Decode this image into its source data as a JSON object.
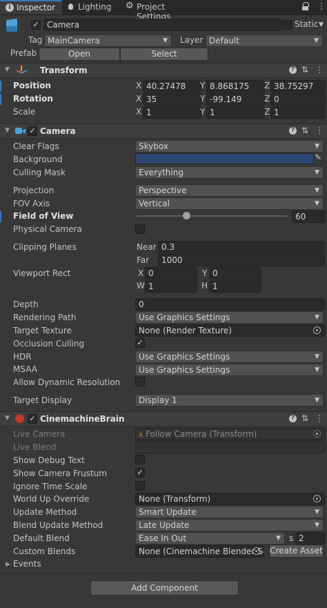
{
  "tabs": [
    {
      "label": "Inspector"
    },
    {
      "label": "Lighting"
    },
    {
      "label": "Project Settings"
    }
  ],
  "object": {
    "name": "Camera",
    "static_label": "Static",
    "tag_label": "Tag",
    "tag_value": "MainCamera",
    "layer_label": "Layer",
    "layer_value": "Default",
    "prefab_label": "Prefab",
    "open_label": "Open",
    "select_label": "Select"
  },
  "transform": {
    "title": "Transform",
    "position_label": "Position",
    "position": {
      "x": "40.27478",
      "y": "8.868175",
      "z": "38.75297"
    },
    "rotation_label": "Rotation",
    "rotation": {
      "x": "35",
      "y": "-99.149",
      "z": "0"
    },
    "scale_label": "Scale",
    "scale": {
      "x": "1",
      "y": "1",
      "z": "1"
    }
  },
  "camera": {
    "title": "Camera",
    "clear_flags_label": "Clear Flags",
    "clear_flags": "Skybox",
    "background_label": "Background",
    "background_color": "#2e4873",
    "culling_mask_label": "Culling Mask",
    "culling_mask": "Everything",
    "projection_label": "Projection",
    "projection": "Perspective",
    "fov_axis_label": "FOV Axis",
    "fov_axis": "Vertical",
    "fov_label": "Field of View",
    "fov_value": "60",
    "fov_slider_fraction": 0.33,
    "physical_camera_label": "Physical Camera",
    "clipping_label": "Clipping Planes",
    "near_label": "Near",
    "near": "0.3",
    "far_label": "Far",
    "far": "1000",
    "viewport_label": "Viewport Rect",
    "vp_x_label": "X",
    "vp_x": "0",
    "vp_y_label": "Y",
    "vp_y": "0",
    "vp_w_label": "W",
    "vp_w": "1",
    "vp_h_label": "H",
    "vp_h": "1",
    "depth_label": "Depth",
    "depth": "0",
    "rendering_path_label": "Rendering Path",
    "rendering_path": "Use Graphics Settings",
    "target_texture_label": "Target Texture",
    "target_texture": "None (Render Texture)",
    "occlusion_label": "Occlusion Culling",
    "hdr_label": "HDR",
    "hdr": "Use Graphics Settings",
    "msaa_label": "MSAA",
    "msaa": "Use Graphics Settings",
    "dynres_label": "Allow Dynamic Resolution",
    "target_display_label": "Target Display",
    "target_display": "Display 1"
  },
  "brain": {
    "title": "CinemachineBrain",
    "live_camera_label": "Live Camera",
    "live_camera": "Follow Camera (Transform)",
    "live_blend_label": "Live Blend",
    "show_debug_label": "Show Debug Text",
    "show_frustum_label": "Show Camera Frustum",
    "ignore_time_label": "Ignore Time Scale",
    "world_up_label": "World Up Override",
    "world_up": "None (Transform)",
    "update_method_label": "Update Method",
    "update_method": "Smart Update",
    "blend_update_label": "Blend Update Method",
    "blend_update": "Late Update",
    "default_blend_label": "Default Blend",
    "default_blend": "Ease In Out",
    "blend_s_label": "s",
    "blend_s": "2",
    "custom_blends_label": "Custom Blends",
    "custom_blends": "None (Cinemachine Blender Se",
    "create_asset_label": "Create Asset",
    "events_label": "Events"
  },
  "add_component_label": "Add Component"
}
